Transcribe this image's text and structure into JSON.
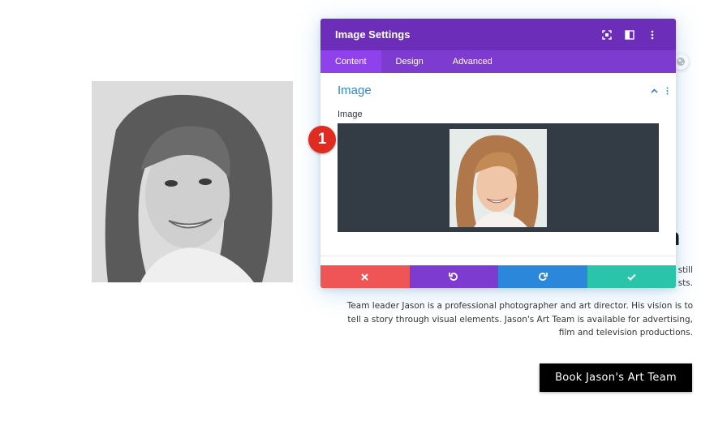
{
  "page": {
    "heading_fragment": "n",
    "copy_fragment_1": "still",
    "copy_fragment_2": "sts.",
    "paragraph": "Team leader Jason is a professional photographer and art director. His vision is to tell a story through visual elements. Jason's Art Team is available for advertising, film and television productions.",
    "cta_label": "Book Jason's Art Team"
  },
  "modal": {
    "title": "Image Settings",
    "header_icons": [
      "focus-mode-icon",
      "split-view-icon",
      "more-options-icon"
    ],
    "tabs": [
      {
        "label": "Content",
        "active": true
      },
      {
        "label": "Design",
        "active": false
      },
      {
        "label": "Advanced",
        "active": false
      }
    ],
    "section_title": "Image",
    "field_label": "Image",
    "footer_buttons": [
      "discard-icon",
      "undo-icon",
      "redo-icon",
      "save-check-icon"
    ]
  },
  "annotation": {
    "step_number": "1"
  },
  "colors": {
    "header_purple": "#6c2eb9",
    "tab_purple": "#7d3bcf",
    "active_tab": "#8f42ec",
    "section_blue": "#2b87da",
    "upload_bg": "#333b44",
    "discard_red": "#ef5555",
    "save_teal": "#29c4a9",
    "badge_red": "#e02b20"
  }
}
